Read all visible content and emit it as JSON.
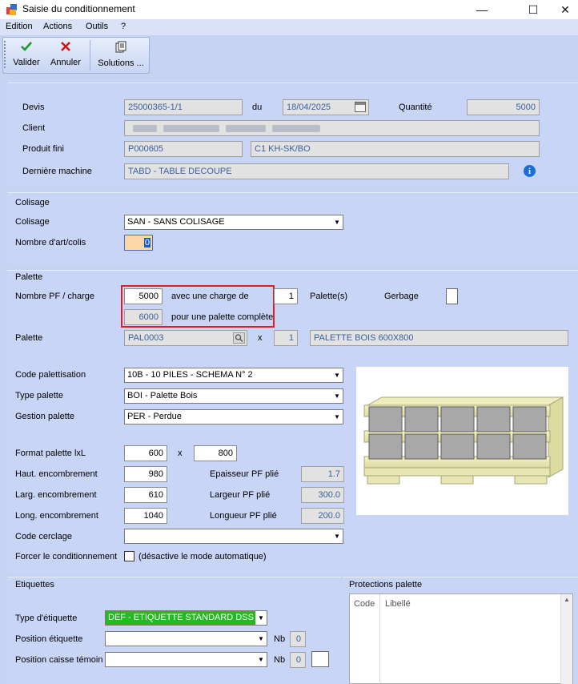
{
  "window": {
    "title": "Saisie du conditionnement",
    "minimize": "—",
    "maximize": "☐",
    "close": "✕"
  },
  "menu": [
    "Edition",
    "Actions",
    "Outils",
    "?"
  ],
  "toolbar": {
    "validate": "Valider",
    "cancel": "Annuler",
    "solutions": "Solutions ..."
  },
  "header": {
    "devis_label": "Devis",
    "devis": "25000365-1/1",
    "du_label": "du",
    "date": "18/04/2025",
    "quantite_label": "Quantité",
    "quantite": "5000",
    "client_label": "Client",
    "produit_label": "Produit fini",
    "produit_code": "P000605",
    "produit_desc": "C1 KH-SK/BO",
    "machine_label": "Dernière machine",
    "machine": "TABD   - TABLE DECOUPE"
  },
  "colisage": {
    "title": "Colisage",
    "colisage_label": "Colisage",
    "colisage": "SAN - SANS COLISAGE",
    "nb_label": "Nombre d'art/colis",
    "nb": "0"
  },
  "palette": {
    "title": "Palette",
    "nb_pf_label": "Nombre PF / charge",
    "nb_pf": "5000",
    "charge_text": "avec une charge de",
    "charge": "1",
    "palettes_label": "Palette(s)",
    "gerbage_label": "Gerbage",
    "complete_value": "6000",
    "complete_text": "pour une palette complète",
    "palette_label": "Palette",
    "palette_code": "PAL0003",
    "x": "x",
    "palette_qty": "1",
    "palette_desc": "PALETTE BOIS 600X800",
    "code_pal_label": "Code palettisation",
    "code_pal": "10B - 10 PILES - SCHEMA N° 2",
    "type_label": "Type palette",
    "type": "BOI - Palette Bois",
    "gestion_label": "Gestion palette",
    "gestion": "PER - Perdue",
    "format_label": "Format palette lxL",
    "format_l": "600",
    "format_x": "x",
    "format_L": "800",
    "haut_label": "Haut. encombrement",
    "haut": "980",
    "epaisseur_label": "Epaisseur PF plié",
    "epaisseur": "1.7",
    "larg_label": "Larg. encombrement",
    "larg": "610",
    "largeur_label": "Largeur PF plié",
    "largeur": "300.0",
    "long_label": "Long. encombrement",
    "long": "1040",
    "longueur_label": "Longueur PF plié",
    "longueur": "200.0",
    "cerclage_label": "Code cerclage",
    "cerclage": "",
    "forcer_label": "Forcer le conditionnement",
    "forcer_note": "(désactive le mode automatique)"
  },
  "etiquettes": {
    "title": "Etiquettes",
    "type_label": "Type d'étiquette",
    "type": "DEF - ETIQUETTE STANDARD DSS",
    "position_label": "Position étiquette",
    "position": "",
    "nb_label": "Nb",
    "nb": "0",
    "temoin_label": "Position caisse témoin",
    "temoin": "",
    "nb2_label": "Nb",
    "nb2": "0"
  },
  "protections": {
    "title": "Protections palette",
    "col_code": "Code",
    "col_libelle": "Libellé"
  },
  "colors": {
    "accent_red": "#e31b23",
    "green_select": "#22bb22",
    "panel": "#c9d5f6"
  }
}
